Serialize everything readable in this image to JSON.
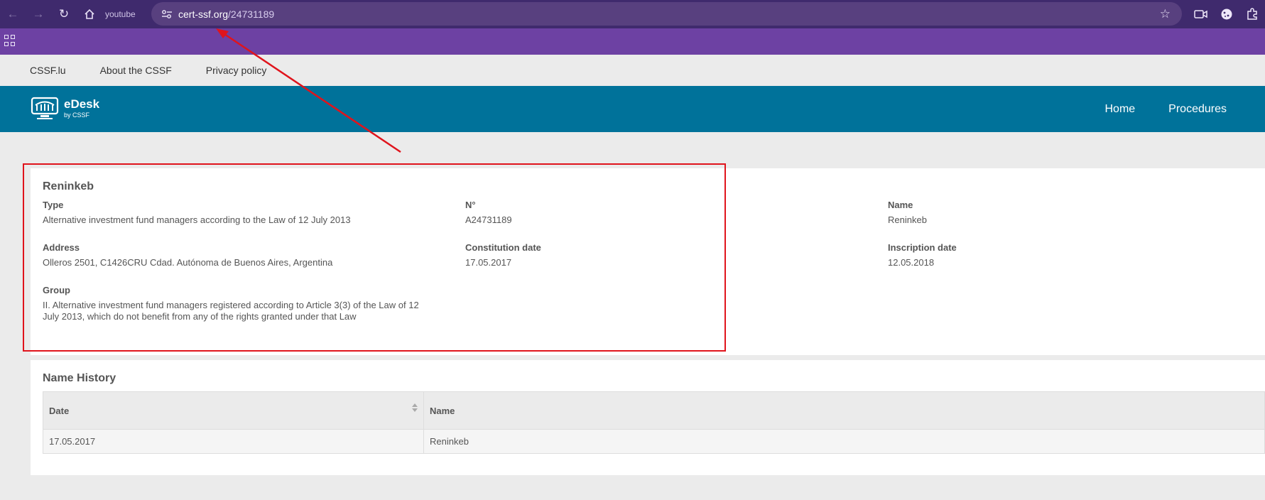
{
  "browser": {
    "tab_hint": "youtube",
    "url_host": "cert-ssf.org",
    "url_path": "/24731189"
  },
  "top_links": [
    "CSSF.lu",
    "About the CSSF",
    "Privacy policy"
  ],
  "header": {
    "logo_title": "eDesk",
    "logo_subtitle": "by CSSF",
    "nav": [
      "Home",
      "Procedures"
    ]
  },
  "entity": {
    "title": "Reninkeb",
    "type_label": "Type",
    "type_value": "Alternative investment fund managers according to the Law of 12 July 2013",
    "number_label": "N°",
    "number_value": "A24731189",
    "name_label": "Name",
    "name_value": "Reninkeb",
    "address_label": "Address",
    "address_value": "Olleros 2501, C1426CRU Cdad. Autónoma de Buenos Aires, Argentina",
    "constitution_label": "Constitution date",
    "constitution_value": "17.05.2017",
    "inscription_label": "Inscription date",
    "inscription_value": "12.05.2018",
    "group_label": "Group",
    "group_value": "II. Alternative investment fund managers registered according to Article 3(3) of the Law of 12 July 2013, which do not benefit from any of the rights granted under that Law"
  },
  "history": {
    "title": "Name History",
    "columns": [
      "Date",
      "Name"
    ],
    "rows": [
      {
        "date": "17.05.2017",
        "name": "Reninkeb"
      }
    ]
  },
  "colors": {
    "browser_bar": "#3f2a6d",
    "bookmarks_bar": "#6d41a3",
    "header": "#00729a",
    "annotation": "#e0141c"
  }
}
